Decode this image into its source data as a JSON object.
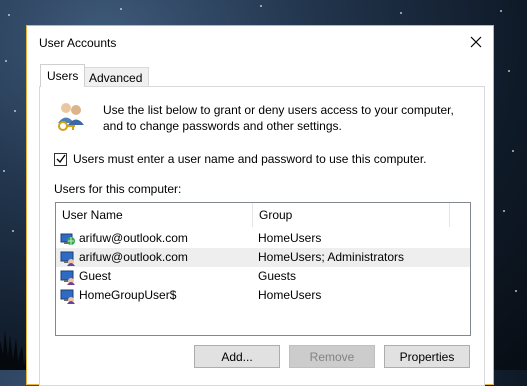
{
  "window": {
    "title": "User Accounts"
  },
  "tabs": [
    {
      "label": "Users",
      "active": true
    },
    {
      "label": "Advanced",
      "active": false
    }
  ],
  "users_tab": {
    "intro_text": "Use the list below to grant or deny users access to your computer, and to change passwords and other settings.",
    "must_login_label": "Users must enter a user name and password to use this computer.",
    "must_login_checked": true,
    "users_list_label": "Users for this computer:",
    "columns": [
      "User Name",
      "Group"
    ],
    "rows": [
      {
        "name": "arifuw@outlook.com",
        "group": "HomeUsers",
        "icon": "online-user-icon"
      },
      {
        "name": "arifuw@outlook.com",
        "group": "HomeUsers; Administrators",
        "icon": "admin-user-icon",
        "selected": true
      },
      {
        "name": "Guest",
        "group": "Guests",
        "icon": "admin-user-icon"
      },
      {
        "name": "HomeGroupUser$",
        "group": "HomeUsers",
        "icon": "admin-user-icon"
      }
    ]
  },
  "buttons": {
    "add": "Add...",
    "remove": "Remove",
    "properties": "Properties"
  },
  "colors": {
    "window_border": "#e8b33f",
    "selected_row": "#eeeeee"
  }
}
